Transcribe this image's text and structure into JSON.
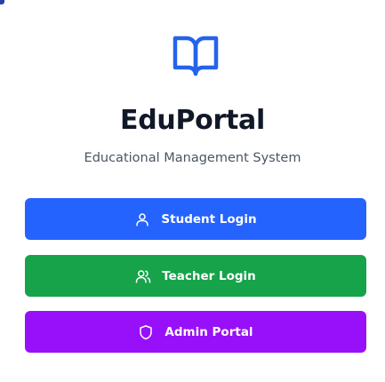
{
  "colors": {
    "student": "#2563ff",
    "teacher": "#16a34a",
    "admin": "#9810fa",
    "logo": "#2563eb",
    "title": "#111827",
    "subtitle": "#4b5563"
  },
  "header": {
    "logo_icon": "open-book-icon",
    "title": "EduPortal",
    "subtitle": "Educational Management System"
  },
  "actions": [
    {
      "label": "Student Login",
      "icon": "user-icon"
    },
    {
      "label": "Teacher Login",
      "icon": "users-icon"
    },
    {
      "label": "Admin Portal",
      "icon": "shield-icon"
    }
  ]
}
